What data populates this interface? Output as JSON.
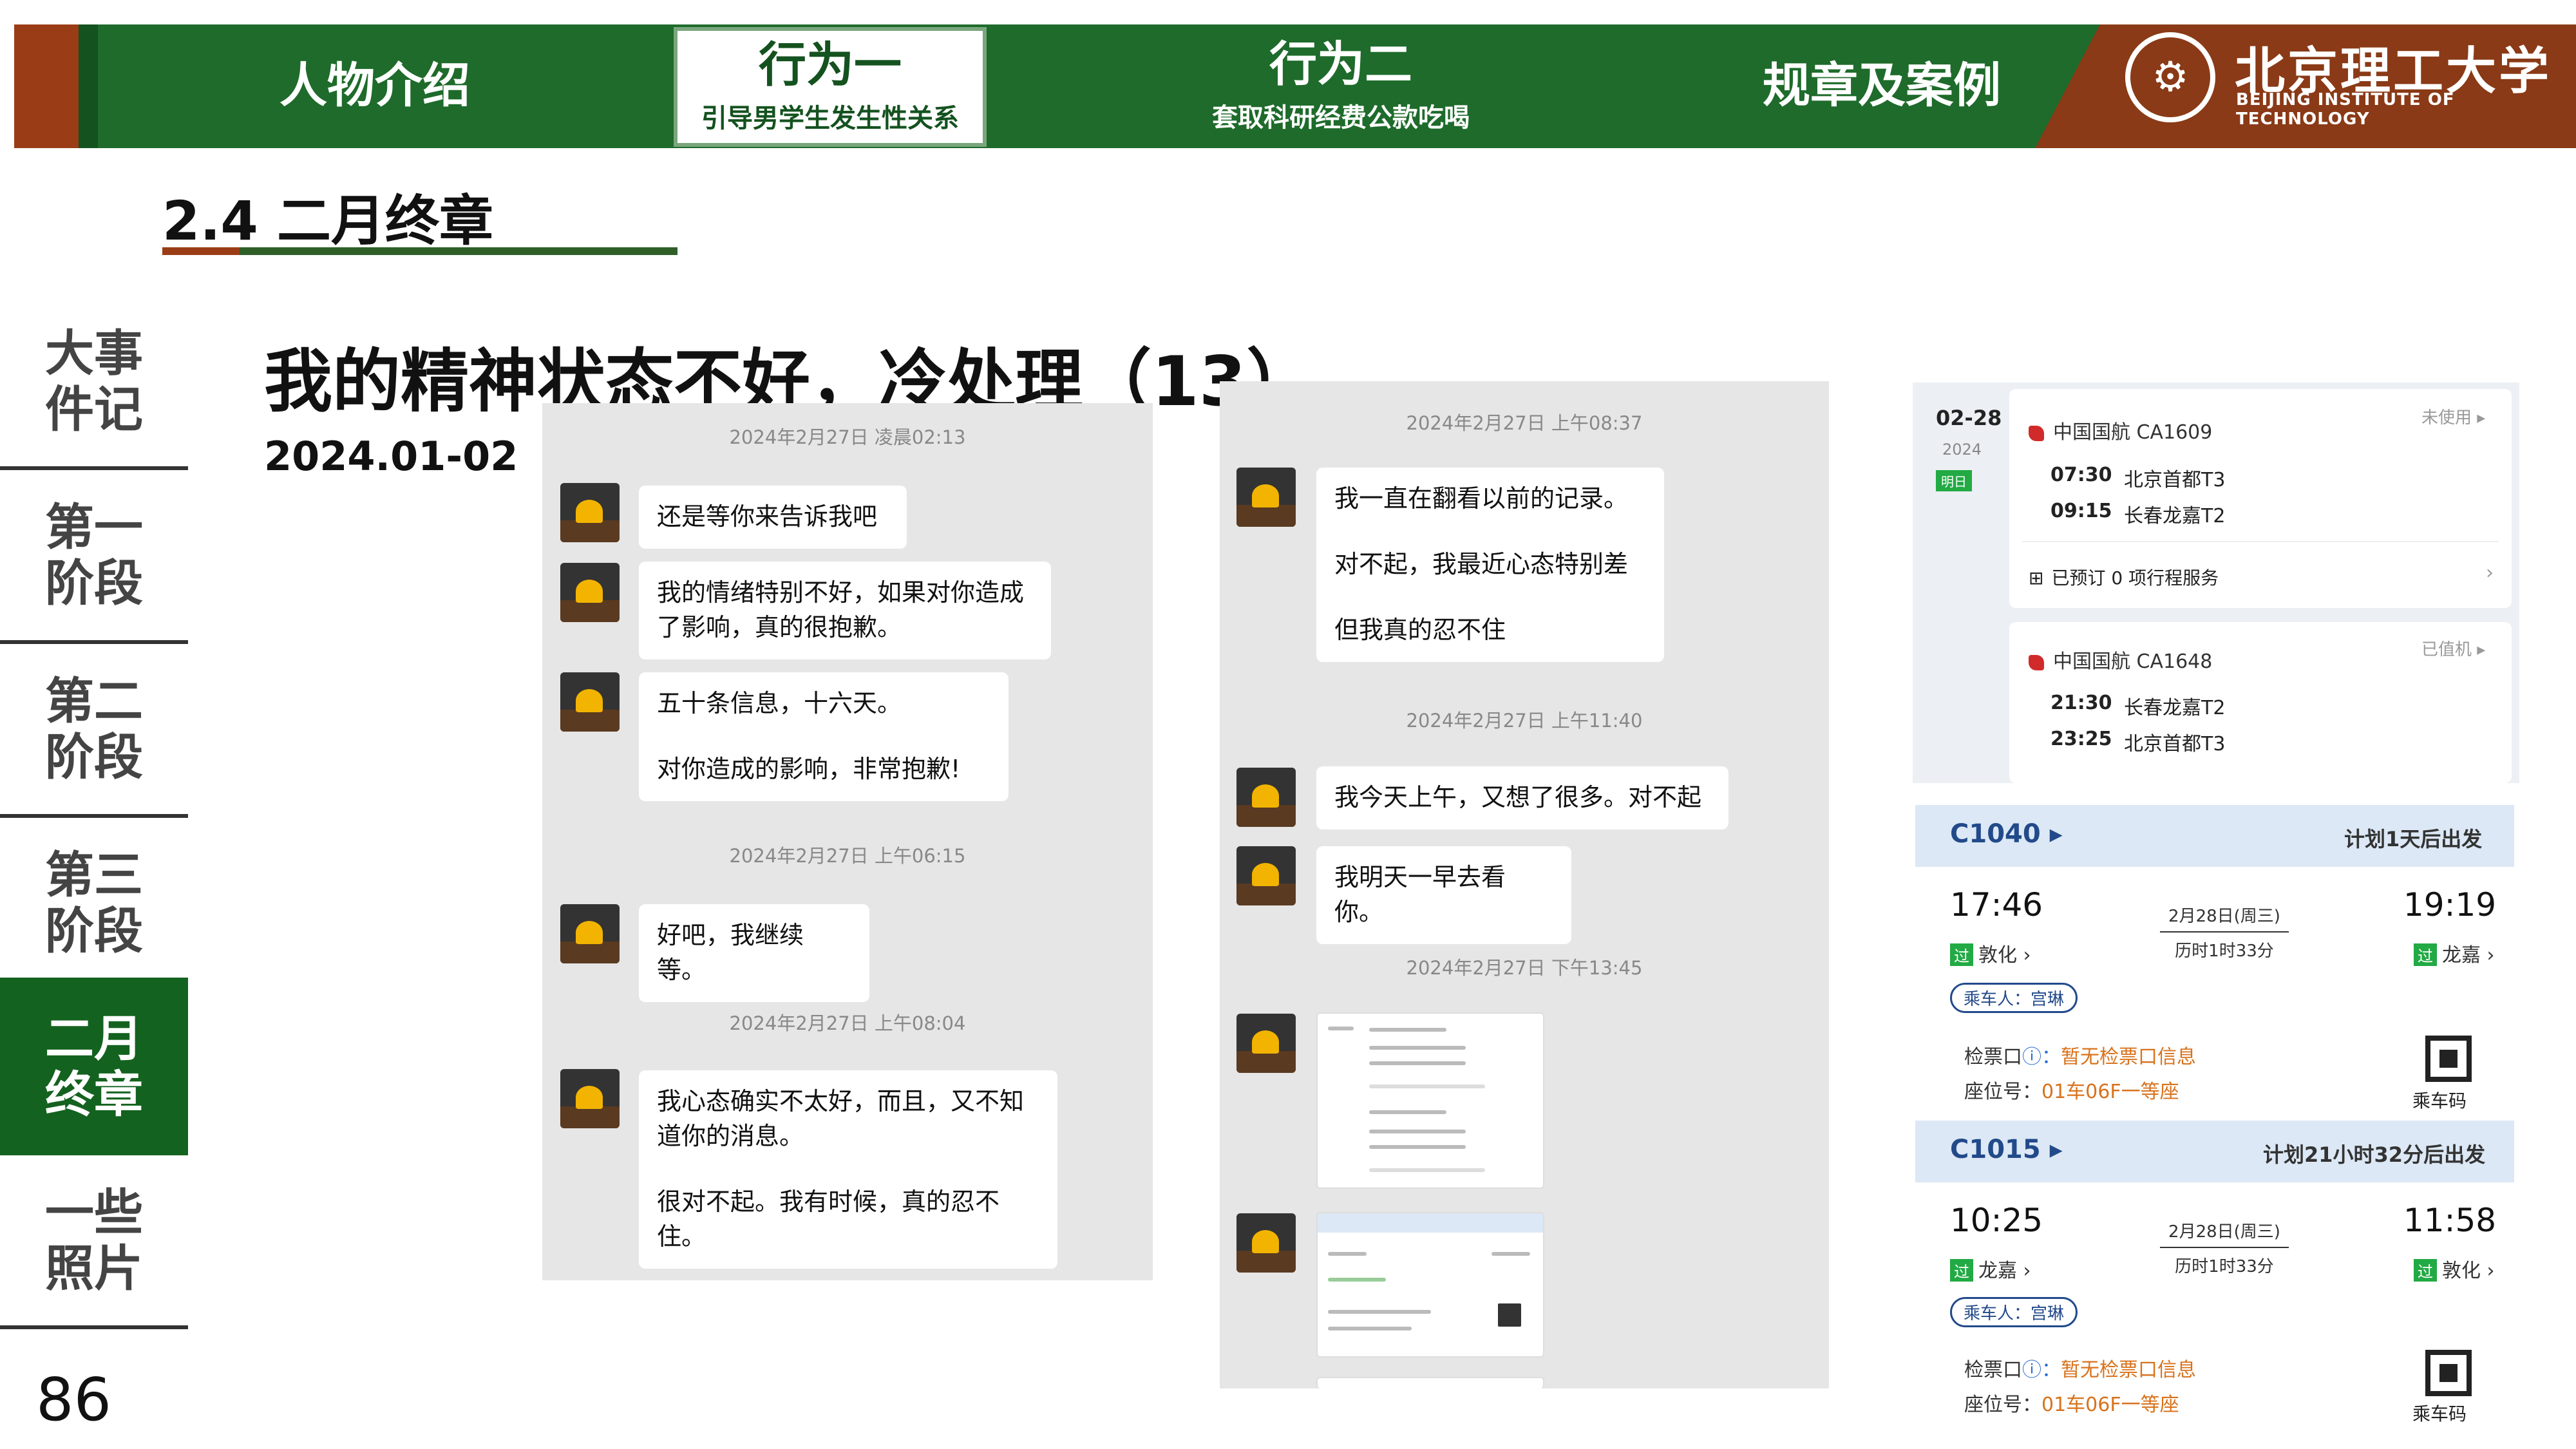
{
  "header": {
    "tabs": [
      {
        "title": "人物介绍",
        "subtitle": ""
      },
      {
        "title": "行为一",
        "subtitle": "引导男学生发生性关系"
      },
      {
        "title": "行为二",
        "subtitle": "套取科研经费公款吃喝"
      },
      {
        "title": "规章及案例",
        "subtitle": ""
      }
    ],
    "logo": {
      "cn": "北京理工大学",
      "en": "BEIJING INSTITUTE OF TECHNOLOGY"
    }
  },
  "section": {
    "title": "2.4 二月终章"
  },
  "sidebar": {
    "items": [
      {
        "label": "大事\n件记"
      },
      {
        "label": "第一\n阶段"
      },
      {
        "label": "第二\n阶段"
      },
      {
        "label": "第三\n阶段"
      },
      {
        "label": "二月\n终章"
      },
      {
        "label": "一些\n照片"
      }
    ],
    "active_index": 4
  },
  "page_number": "86",
  "main": {
    "title": "我的精神状态不好，冷处理（13）",
    "date": "2024.01-02"
  },
  "chat1": {
    "ts1": "2024年2月27日 凌晨02:13",
    "m1": "还是等你来告诉我吧",
    "m2": "我的情绪特别不好，如果对你造成了影响，真的很抱歉。",
    "m3a": "五十条信息，十六天。",
    "m3b": "对你造成的影响，非常抱歉!",
    "ts2": "2024年2月27日 上午06:15",
    "m4": "好吧，我继续等。",
    "ts3": "2024年2月27日 上午08:04",
    "m5a": "我心态确实不太好，而且，又不知道你的消息。",
    "m5b": "很对不起。我有时候，真的忍不住。"
  },
  "chat2": {
    "ts1": "2024年2月27日 上午08:37",
    "m1a": "我一直在翻看以前的记录。",
    "m1b": "对不起，我最近心态特别差",
    "m1c": "但我真的忍不住",
    "ts2": "2024年2月27日 上午11:40",
    "m2": "我今天上午，又想了很多。对不起",
    "m3": "我明天一早去看你。",
    "ts3": "2024年2月27日 下午13:45"
  },
  "flights": {
    "date": "02-28",
    "year": "2024",
    "tag": "明日",
    "f1": {
      "airline": "中国国航 CA1609",
      "status": "未使用 ▸",
      "dep_time": "07:30",
      "dep": "北京首都T3",
      "arr_time": "09:15",
      "arr": "长春龙嘉T2",
      "service": "已预订 0 项行程服务"
    },
    "f2": {
      "airline": "中国国航 CA1648",
      "status": "已值机 ▸",
      "dep_time": "21:30",
      "dep": "长春龙嘉T2",
      "arr_time": "23:25",
      "arr": "北京首都T3"
    }
  },
  "trains": {
    "t1": {
      "number": "C1040 ▸",
      "plan": "计划1天后出发",
      "dep_time": "17:46",
      "arr_time": "19:19",
      "date": "2月28日(周三)",
      "duration": "历时1时33分",
      "dep": "敦化 ›",
      "arr": "龙嘉 ›",
      "ok": "过",
      "passenger": "乘车人：宫琳",
      "gate_label": "检票口",
      "gate": "暂无检票口信息",
      "seat_label": "座位号：",
      "seat": "01车06F一等座",
      "qr": "乘车码"
    },
    "t2": {
      "number": "C1015 ▸",
      "plan": "计划21小时32分后出发",
      "dep_time": "10:25",
      "arr_time": "11:58",
      "date": "2月28日(周三)",
      "duration": "历时1时33分",
      "dep": "龙嘉 ›",
      "arr": "敦化 ›",
      "ok": "过",
      "passenger": "乘车人：宫琳",
      "gate_label": "检票口",
      "gate": "暂无检票口信息",
      "seat_label": "座位号：",
      "seat": "01车06F一等座",
      "qr": "乘车码"
    }
  },
  "colors": {
    "primary_green": "#1e6b2b",
    "accent_orange": "#9a3d16"
  }
}
